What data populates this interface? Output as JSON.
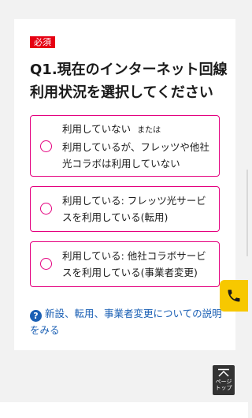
{
  "question": {
    "required_label": "必須",
    "title": "Q1.現在のインターネット回線利用状況を選択してください"
  },
  "options": [
    {
      "line1_main": "利用していない",
      "line1_small": "または",
      "line2": "利用しているが、フレッツや他社光コラボは利用していない"
    },
    {
      "label": "利用している: フレッツ光サービスを利用している(転用)"
    },
    {
      "label": "利用している: 他社コラボサービスを利用している(事業者変更)"
    }
  ],
  "help": {
    "icon": "question-circle-icon",
    "text": "新設、転用、事業者変更についての説明をみる"
  },
  "page_top": {
    "label": "ページ\nトップ",
    "icon": "arrow-up-icon"
  },
  "colors": {
    "accent": "#e4007f",
    "badge": "#e60012",
    "link": "#1a5fb4",
    "phone": "#f7c800"
  }
}
